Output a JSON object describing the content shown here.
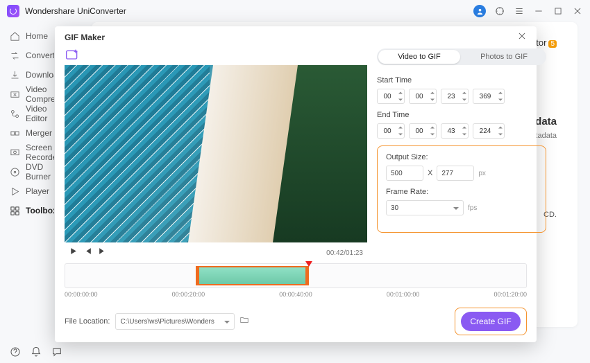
{
  "app": {
    "title": "Wondershare UniConverter"
  },
  "sidebar": {
    "items": [
      {
        "label": "Home"
      },
      {
        "label": "Converter"
      },
      {
        "label": "Downloader"
      },
      {
        "label": "Video Compressor"
      },
      {
        "label": "Video Editor"
      },
      {
        "label": "Merger"
      },
      {
        "label": "Screen Recorder"
      },
      {
        "label": "DVD Burner"
      },
      {
        "label": "Player"
      },
      {
        "label": "Toolbox"
      }
    ]
  },
  "card": {
    "tag_label": "tor",
    "badge": "5",
    "meta_title": "data",
    "meta_sub": "etadata",
    "cd": "CD."
  },
  "dialog": {
    "title": "GIF Maker",
    "tabs": {
      "video": "Video to GIF",
      "photos": "Photos to GIF"
    },
    "start_label": "Start Time",
    "end_label": "End Time",
    "start": {
      "h": "00",
      "m": "00",
      "s": "23",
      "ms": "369"
    },
    "end": {
      "h": "00",
      "m": "00",
      "s": "43",
      "ms": "224"
    },
    "output_label": "Output Size:",
    "out_w": "500",
    "out_h": "277",
    "X": "X",
    "px": "px",
    "fr_label": "Frame Rate:",
    "fr_val": "30",
    "fps": "fps",
    "time_current": "00:42",
    "time_total": "01:23",
    "tl": {
      "t0": "00:00:00:00",
      "t1": "00:00:20:00",
      "t2": "00:00:40:00",
      "t3": "00:01:00:00",
      "t4": "00:01:20:00"
    },
    "file_loc_label": "File Location:",
    "file_path": "C:\\Users\\ws\\Pictures\\Wonders",
    "create": "Create GIF"
  }
}
